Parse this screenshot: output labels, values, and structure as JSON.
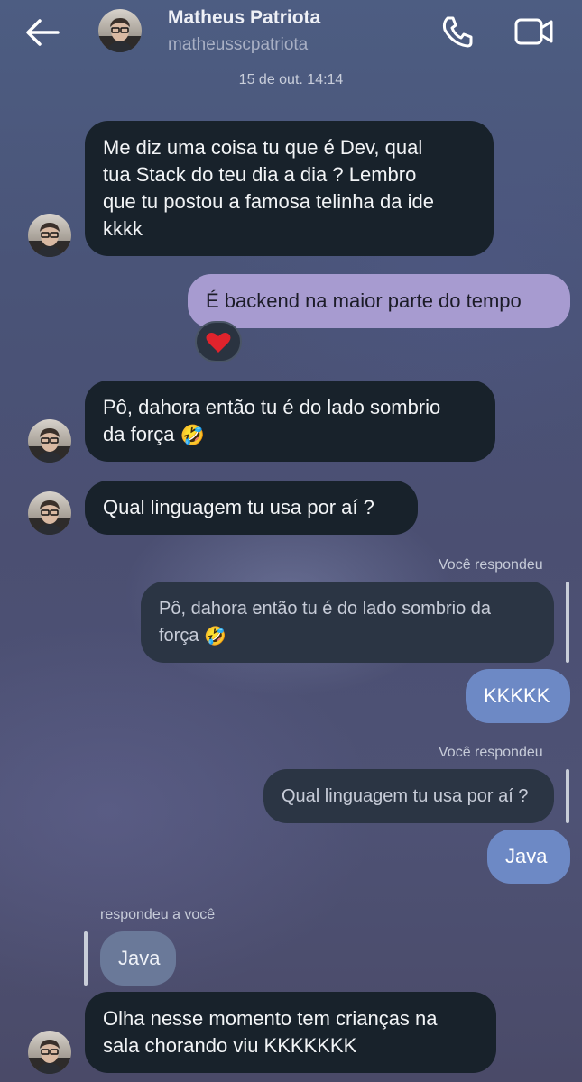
{
  "header": {
    "contact_name": "Matheus Patriota",
    "username": "matheusscpatriota",
    "back_icon": "arrow-left-icon",
    "call_icon": "phone-icon",
    "video_icon": "video-camera-icon"
  },
  "timestamp": "15 de out. 14:14",
  "messages": {
    "m1": {
      "lines": [
        "Me diz uma coisa tu que é Dev, qual",
        "tua Stack do teu dia a dia ? Lembro",
        "que tu postou a famosa telinha da ide",
        "kkkk"
      ]
    },
    "m2": {
      "text": "É backend na maior parte do tempo",
      "reaction": "❤️"
    },
    "m3": {
      "lines": [
        "Pô, dahora então tu é do lado sombrio",
        "da força"
      ],
      "emoji": "🤣"
    },
    "m4": {
      "text": "Qual linguagem tu usa por aí ?"
    },
    "r1": {
      "label": "Você respondeu",
      "quoted_lines": [
        "Pô, dahora então tu é do lado sombrio da",
        "força"
      ],
      "quoted_emoji": "🤣",
      "reply": "KKKKK"
    },
    "r2": {
      "label": "Você respondeu",
      "quoted": "Qual linguagem tu usa por aí ?",
      "reply": "Java"
    },
    "r3": {
      "label": "respondeu a você",
      "quoted": "Java",
      "reply_lines": [
        "Olha nesse momento tem crianças na",
        "sala chorando viu KKKKKKK"
      ]
    }
  },
  "colors": {
    "incoming_bubble": "#18222b",
    "outgoing_bubble": "#a79bd0",
    "outgoing_reply_bubble": "#6d89c5"
  }
}
